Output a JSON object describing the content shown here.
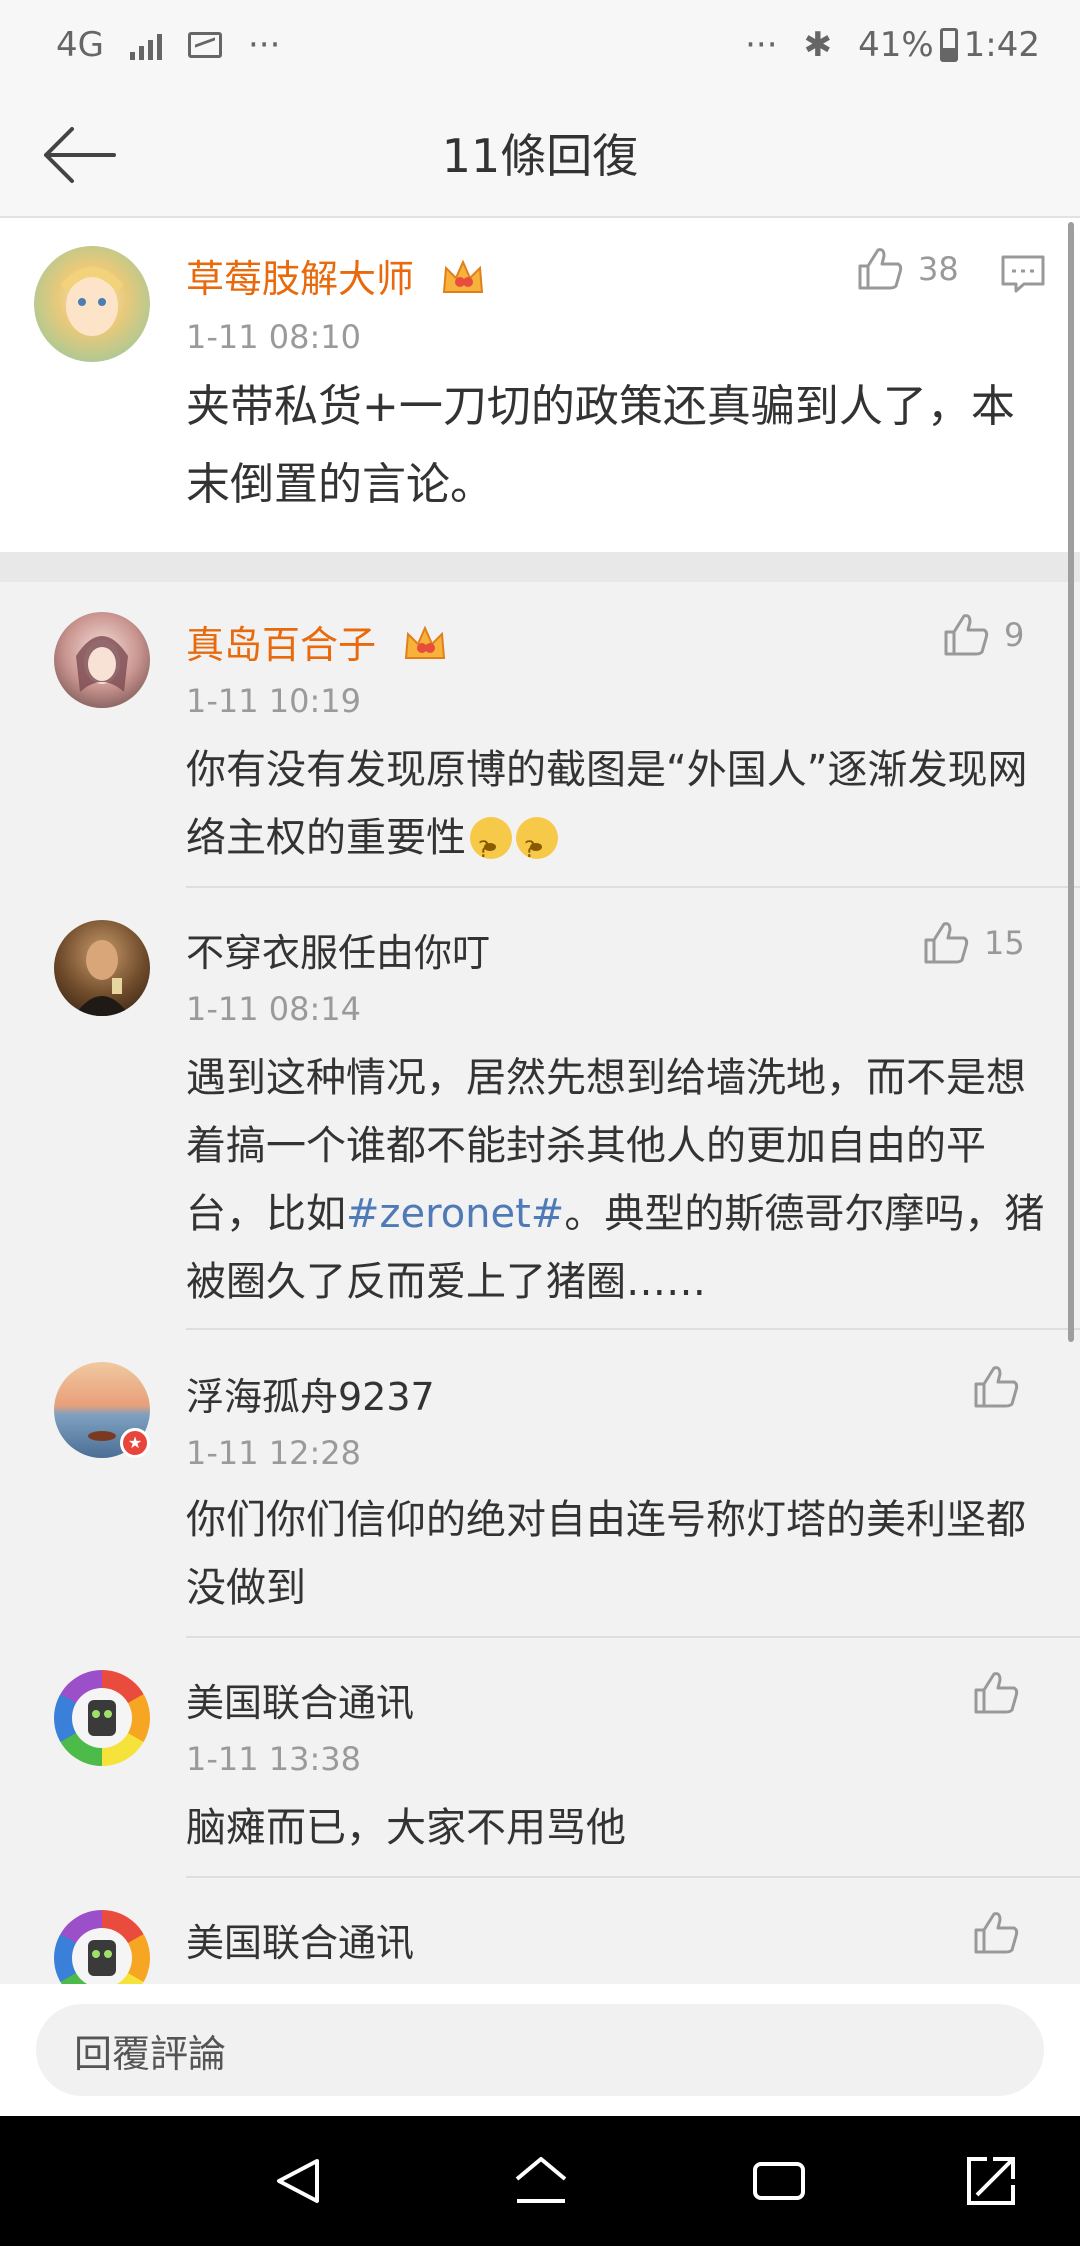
{
  "status_bar": {
    "network": "4G",
    "overflow": "···",
    "overflow_right": "···",
    "bluetooth": "✱",
    "battery_percent": "41%",
    "battery_level": 0.41,
    "time": "1:42"
  },
  "header": {
    "title": "11條回復"
  },
  "main_comment": {
    "username": "草莓肢解大师",
    "time": "1-11 08:10",
    "text": "夹带私货+一刀切的政策还真骗到人了，本末倒置的言论。",
    "likes": "38"
  },
  "replies": [
    {
      "username": "真岛百合子",
      "vip": true,
      "time": "1-11 10:19",
      "text": "你有没有发现原博的截图是“外国人”逐渐发现网络主权的重要性",
      "likes": "9"
    },
    {
      "username": "不穿衣服任由你叮",
      "vip": false,
      "time": "1-11 08:14",
      "text_before": "遇到这种情况，居然先想到给墙洗地，而不是想着搞一个谁都不能封杀其他人的更加自由的平台，比如",
      "hashtag": "#zeronet#",
      "text_after": "。典型的斯德哥尔摩吗，猪被圈久了反而爱上了猪圈……",
      "likes": "15"
    },
    {
      "username": "浮海孤舟9237",
      "vip": false,
      "time": "1-11 12:28",
      "text": "你们你们信仰的绝对自由连号称灯塔的美利坚都没做到",
      "likes": ""
    },
    {
      "username": "美国联合通讯",
      "vip": false,
      "time": "1-11 13:38",
      "text": "脑瘫而已，大家不用骂他",
      "likes": ""
    },
    {
      "username": "美国联合通讯",
      "vip": false,
      "time": "",
      "text": "",
      "likes": ""
    }
  ],
  "reply_bar": {
    "placeholder": "回覆評論"
  },
  "colors": {
    "username_vip": "#e86a0c",
    "hashtag": "#4f7ab8",
    "time": "#9a9a9a"
  }
}
